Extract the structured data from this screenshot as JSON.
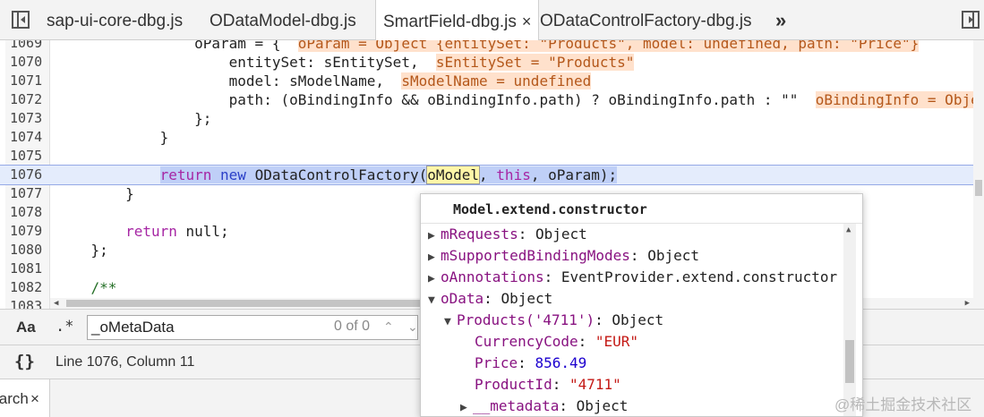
{
  "tabs": {
    "items": [
      {
        "label": "sap-ui-core-dbg.js"
      },
      {
        "label": "ODataModel-dbg.js"
      },
      {
        "label": "SmartField-dbg.js",
        "close": "×"
      },
      {
        "label": "ODataControlFactory-dbg.js"
      }
    ],
    "more": "»"
  },
  "editor": {
    "lines": [
      {
        "num": "1069",
        "pre": "                oParam = {  ",
        "inline": "oParam = Object {entitySet: \"Products\", model: undefined, path: \"Price\"}"
      },
      {
        "num": "1070",
        "pre": "                    entitySet: sEntitySet,  ",
        "inline": "sEntitySet = \"Products\""
      },
      {
        "num": "1071",
        "pre": "                    model: sModelName,  ",
        "inline": "sModelName = undefined"
      },
      {
        "num": "1072",
        "pre": "                    path: (oBindingInfo && oBindingInfo.path) ? oBindingInfo.path : \"\"  ",
        "inline": "oBindingInfo = Object"
      },
      {
        "num": "1073",
        "code": "                };"
      },
      {
        "num": "1074",
        "code": "            }"
      },
      {
        "num": "1075",
        "code": ""
      },
      {
        "num": "1076",
        "indent": "            ",
        "kw_return": "return",
        "kw_new": "new",
        "ctor": "ODataControlFactory(",
        "arg1": "oModel",
        "comma1": ", ",
        "kw_this": "this",
        "rest": ", oParam);"
      },
      {
        "num": "1077",
        "code": "        }"
      },
      {
        "num": "1078",
        "code": ""
      },
      {
        "num": "1079",
        "indent": "        ",
        "kw": "return",
        "rest": " null;"
      },
      {
        "num": "1080",
        "code": "    };"
      },
      {
        "num": "1081",
        "code": ""
      },
      {
        "num": "1082",
        "indent": "    ",
        "comment": "/**"
      },
      {
        "num": "1083",
        "code": ""
      }
    ]
  },
  "search": {
    "case_label": "Aa",
    "regex_label": ".*",
    "query": "_oMetaData",
    "count": "0 of 0",
    "prev": "⌃",
    "next": "⌄"
  },
  "status": {
    "pretty_print": "{}",
    "position": "Line 1076, Column 11"
  },
  "drawer": {
    "tab_label": "Search",
    "close": "×"
  },
  "popover": {
    "title": "Model.extend.constructor",
    "rows": [
      {
        "key": "mRequests",
        "value": "Object",
        "expanded": false
      },
      {
        "key": "mSupportedBindingModes",
        "value": "Object",
        "expanded": false
      },
      {
        "key": "oAnnotations",
        "value": "EventProvider.extend.constructor",
        "expanded": false
      },
      {
        "key": "oData",
        "value": "Object",
        "expanded": true
      },
      {
        "key": "Products('4711')",
        "value": "Object",
        "expanded": true
      },
      {
        "key": "CurrencyCode",
        "value": "\"EUR\""
      },
      {
        "key": "Price",
        "value": "856.49"
      },
      {
        "key": "ProductId",
        "value": "\"4711\""
      },
      {
        "key": "__metadata",
        "value": "Object",
        "expanded": false
      }
    ]
  },
  "watermark": "@稀土掘金技术社区"
}
